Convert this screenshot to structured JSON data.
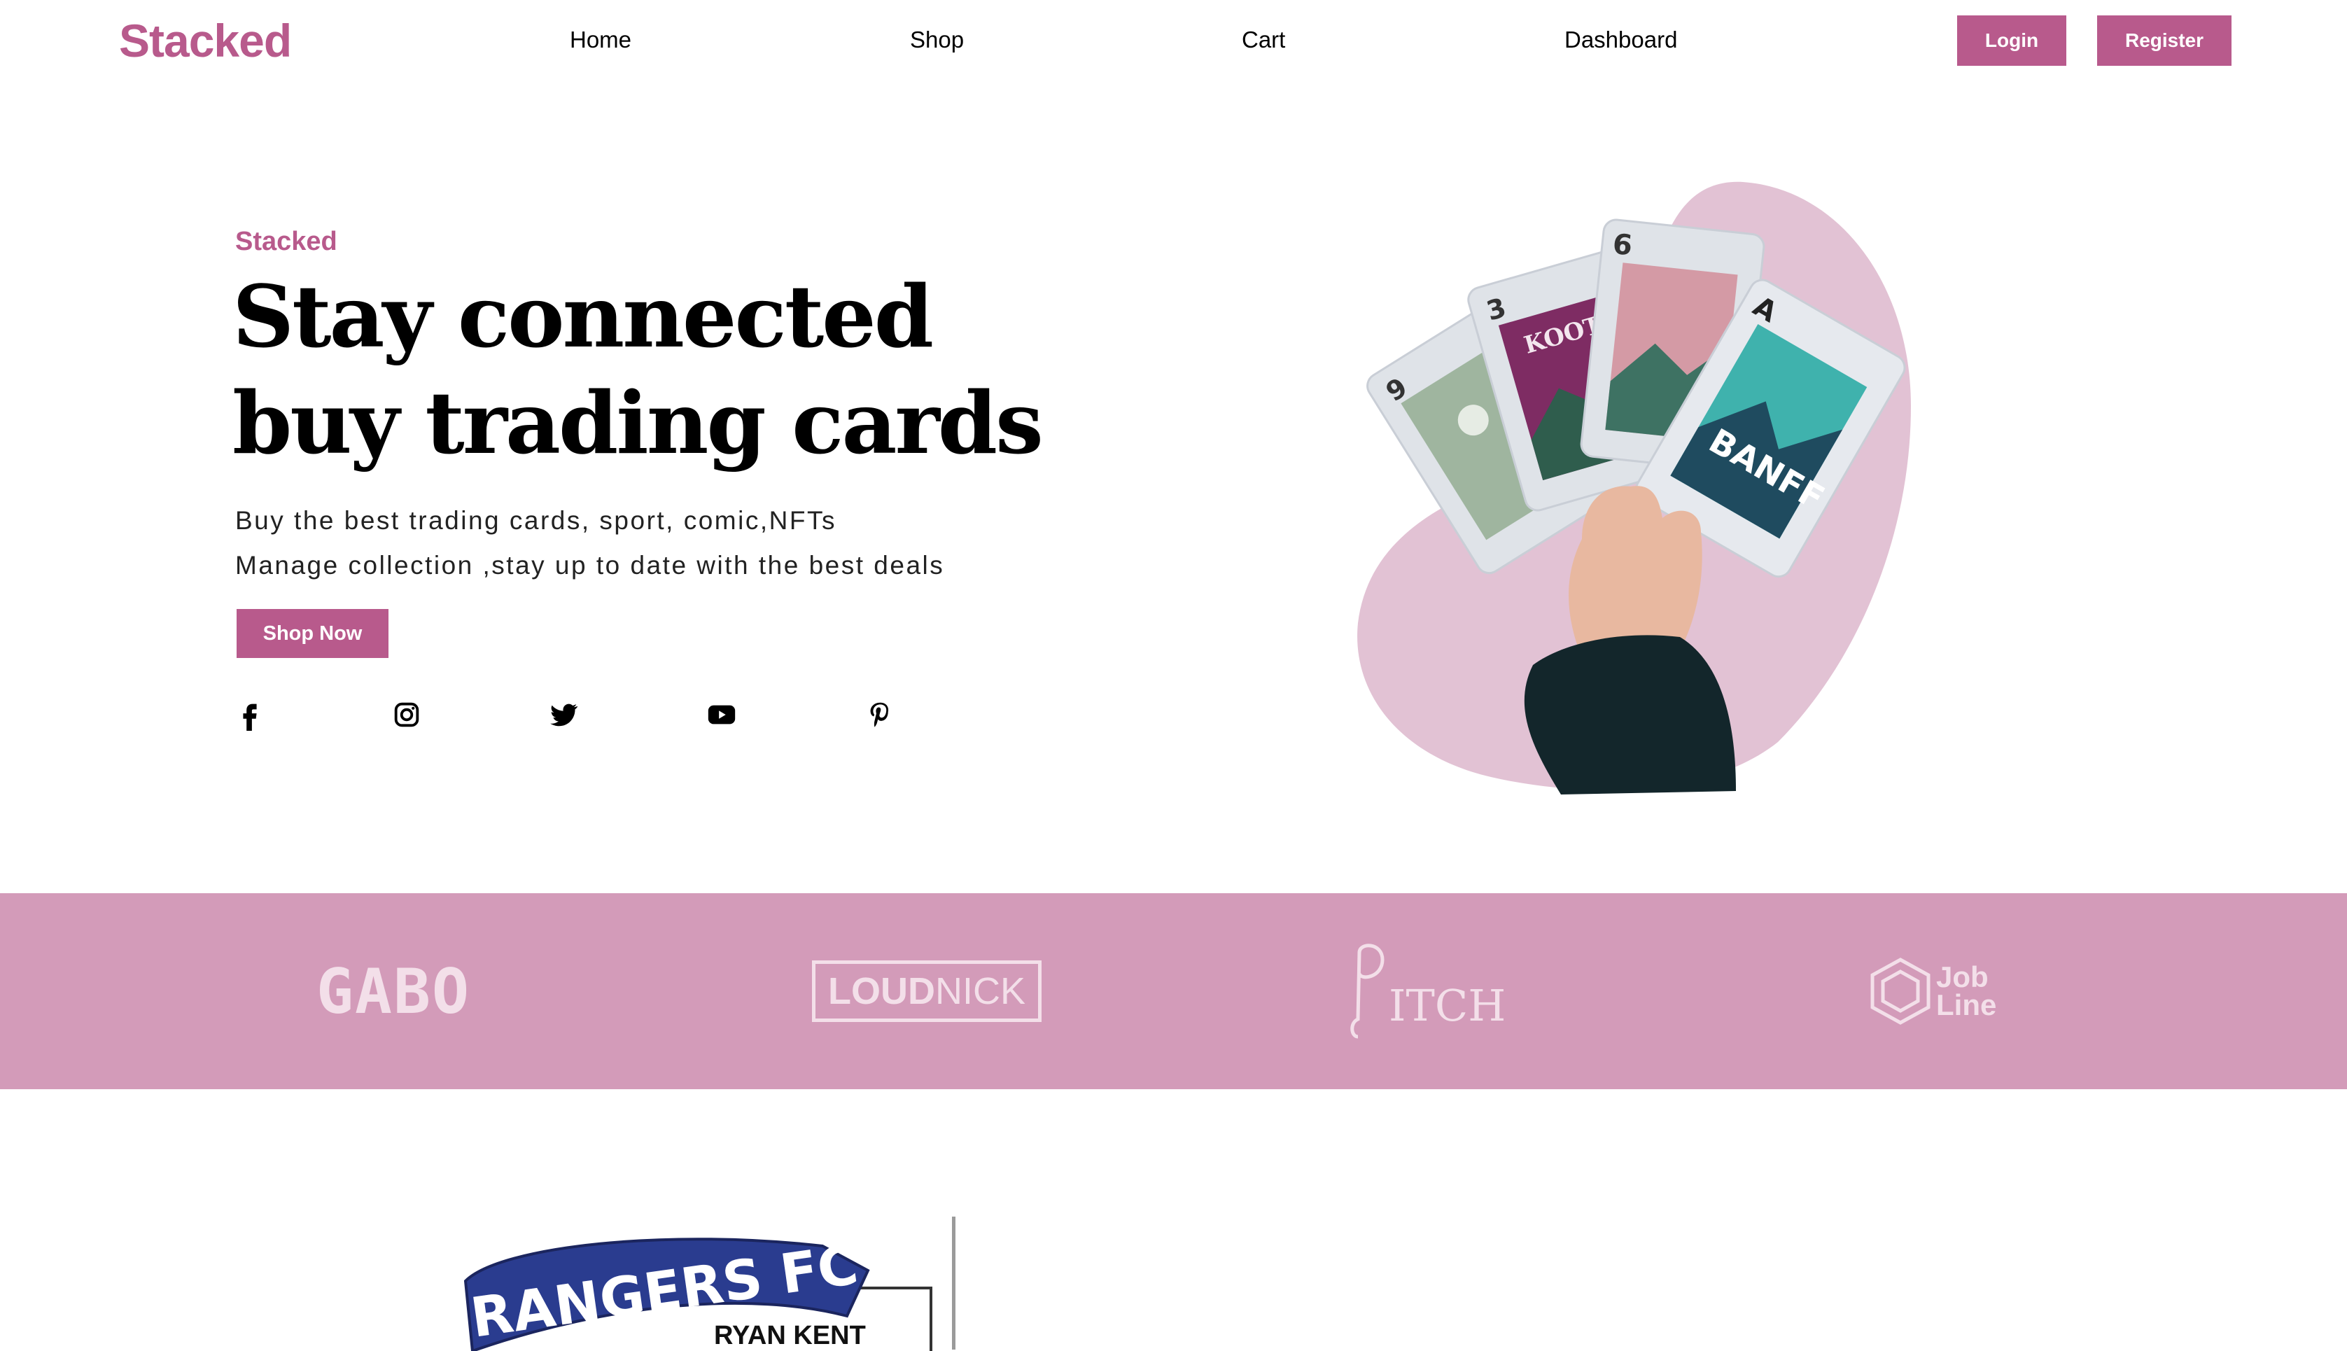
{
  "nav": {
    "brand": "Stacked",
    "links": [
      "Home",
      "Shop",
      "Cart",
      "Dashboard"
    ],
    "login_label": "Login",
    "register_label": "Register"
  },
  "hero": {
    "eyebrow": "Stacked",
    "headline_lines": [
      "Stay connected",
      "buy trading cards"
    ],
    "subtext_lines": [
      "Buy the best trading cards, sport, comic,NFTs",
      "Manage collection ,stay up to date with the best deals"
    ],
    "cta_label": "Shop Now",
    "social_icons": [
      "facebook-icon",
      "instagram-icon",
      "twitter-icon",
      "youtube-icon",
      "pinterest-icon"
    ],
    "card_labels": [
      "BANFF",
      "KOOT"
    ]
  },
  "partners": {
    "logos": [
      "GABO",
      "LOUD",
      "NICK",
      "ITCH",
      "Job",
      "Line"
    ]
  },
  "featured_card": {
    "club": "RANGERS FC",
    "player": "RYAN KENT"
  },
  "colors": {
    "accent": "#b85a8c",
    "band": "#d39bb9",
    "blob": "#e2c2d4"
  }
}
